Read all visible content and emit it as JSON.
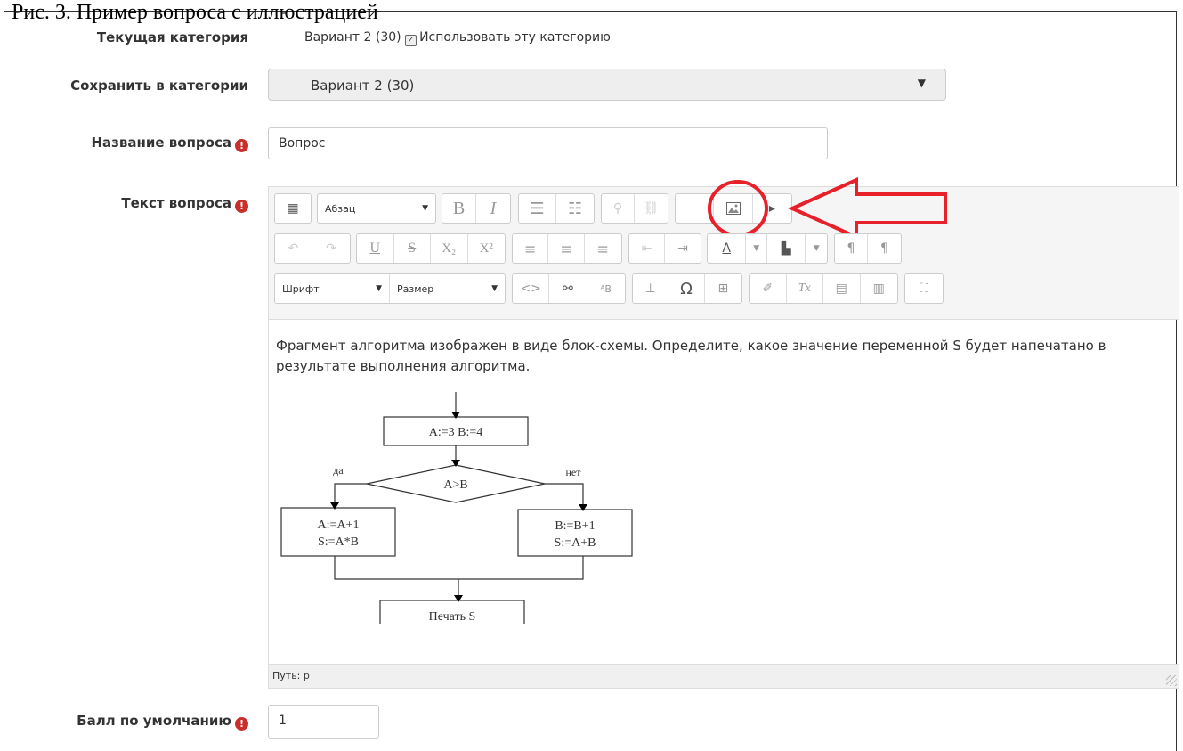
{
  "caption": "Рис. 3. Пример вопроса с иллюстрацией",
  "fields": {
    "current_category": {
      "label": "Текущая категория",
      "value": "Вариант 2 (30)",
      "checkbox_label": "Использовать эту категорию"
    },
    "save_in_category": {
      "label": "Сохранить в категории",
      "value": "Вариант 2 (30)"
    },
    "question_name": {
      "label": "Название вопроса",
      "value": "Вопрос"
    },
    "question_text": {
      "label": "Текст вопроса"
    },
    "default_mark": {
      "label": "Балл по умолчанию",
      "value": "1"
    }
  },
  "toolbar": {
    "format_select": "Абзац",
    "font_select": "Шрифт",
    "size_select": "Размер"
  },
  "editor": {
    "text": "Фрагмент алгоритма изображен в виде блок-схемы. Определите, какое значение переменной S будет напечатано в результате выполнения алгоритма.",
    "path": "Путь: p"
  },
  "flowchart": {
    "init": "A:=3    B:=4",
    "condition": "A>B",
    "yes": "да",
    "no": "нет",
    "yes_line1": "A:=A+1",
    "yes_line2": "S:=A*B",
    "no_line1": "B:=B+1",
    "no_line2": "S:=A+B",
    "print": "Печать S"
  },
  "icons": [
    "table-icon",
    "bold-icon",
    "italic-icon",
    "bullet-list-icon",
    "numbered-list-icon",
    "link-icon",
    "unlink-icon",
    "image-icon",
    "media-icon",
    "undo-icon",
    "redo-icon",
    "underline-icon",
    "strikethrough-icon",
    "subscript-icon",
    "superscript-icon",
    "align-left-icon",
    "align-center-icon",
    "align-right-icon",
    "outdent-icon",
    "indent-icon",
    "text-color-icon",
    "background-color-icon",
    "ltr-icon",
    "rtl-icon",
    "code-icon",
    "search-replace-icon",
    "char-map-icon",
    "anchor-icon",
    "omega-icon",
    "table-grid-icon",
    "clear-format-icon",
    "remove-format-icon",
    "paste-text-icon",
    "paste-word-icon",
    "fullscreen-icon"
  ],
  "colors": {
    "annotation": "#e8202a",
    "required": "#c9302c"
  }
}
